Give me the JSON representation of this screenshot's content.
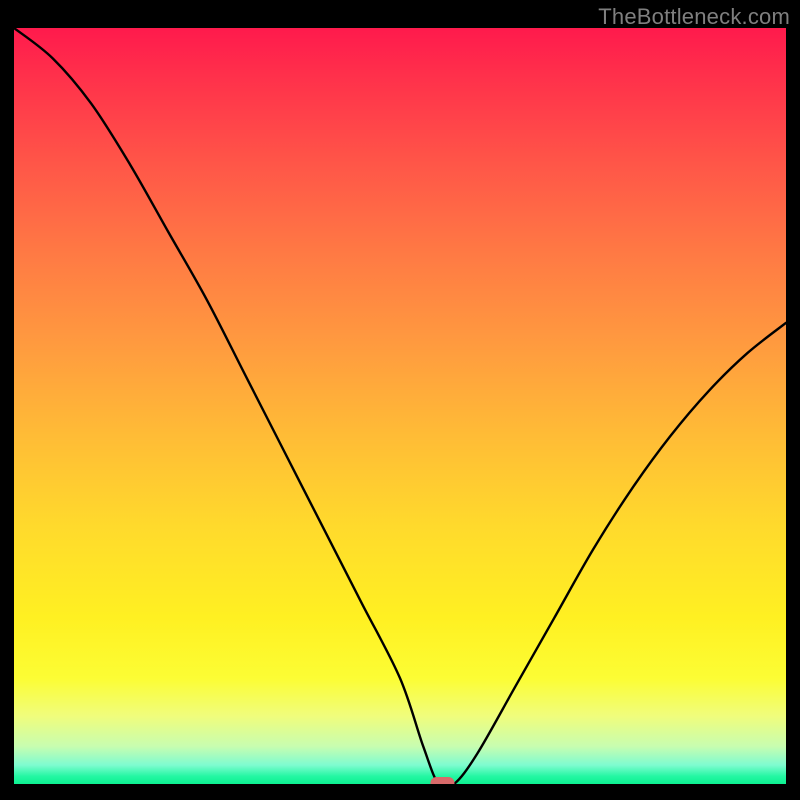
{
  "watermark": "TheBottleneck.com",
  "chart_data": {
    "type": "line",
    "title": "",
    "xlabel": "",
    "ylabel": "",
    "xlim": [
      0,
      100
    ],
    "ylim": [
      0,
      100
    ],
    "grid": false,
    "legend": false,
    "x": [
      0,
      5,
      10,
      15,
      20,
      25,
      30,
      35,
      40,
      45,
      50,
      53,
      55,
      57,
      60,
      65,
      70,
      75,
      80,
      85,
      90,
      95,
      100
    ],
    "values": [
      100,
      96,
      90,
      82,
      73,
      64,
      54,
      44,
      34,
      24,
      14,
      5,
      0,
      0,
      4,
      13,
      22,
      31,
      39,
      46,
      52,
      57,
      61
    ],
    "highlight_point": {
      "x": 55.5,
      "y": 0,
      "color": "#d86a6a"
    }
  },
  "gradient_stops": [
    {
      "pos": 0,
      "color": "#ff1a4c"
    },
    {
      "pos": 6,
      "color": "#ff2f4b"
    },
    {
      "pos": 18,
      "color": "#ff5648"
    },
    {
      "pos": 30,
      "color": "#ff7a44"
    },
    {
      "pos": 42,
      "color": "#ff9b3f"
    },
    {
      "pos": 54,
      "color": "#ffbc36"
    },
    {
      "pos": 66,
      "color": "#ffda2c"
    },
    {
      "pos": 78,
      "color": "#fff022"
    },
    {
      "pos": 86,
      "color": "#fcfd34"
    },
    {
      "pos": 91,
      "color": "#f0fd7c"
    },
    {
      "pos": 95,
      "color": "#c8fdb0"
    },
    {
      "pos": 97.5,
      "color": "#7efcd0"
    },
    {
      "pos": 99,
      "color": "#23f7a2"
    },
    {
      "pos": 100,
      "color": "#0cf191"
    }
  ]
}
